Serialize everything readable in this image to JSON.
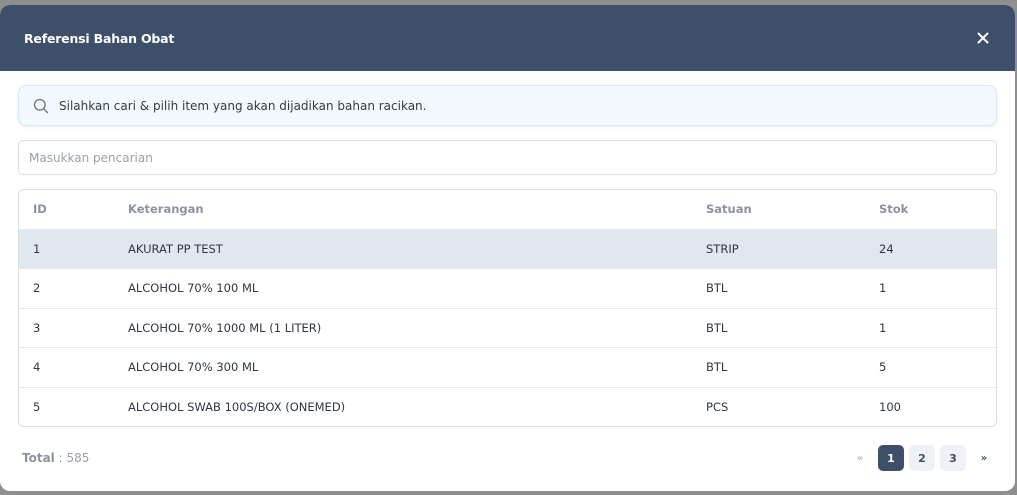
{
  "modal": {
    "title": "Referensi Bahan Obat"
  },
  "info": {
    "text": "Silahkan cari & pilih item yang akan dijadikan bahan racikan."
  },
  "search": {
    "placeholder": "Masukkan pencarian",
    "value": ""
  },
  "table": {
    "headers": [
      "ID",
      "Keterangan",
      "Satuan",
      "Stok"
    ],
    "rows": [
      {
        "id": "1",
        "keterangan": "AKURAT PP TEST",
        "satuan": "STRIP",
        "stok": "24",
        "selected": true
      },
      {
        "id": "2",
        "keterangan": "ALCOHOL 70% 100 ML",
        "satuan": "BTL",
        "stok": "1",
        "selected": false
      },
      {
        "id": "3",
        "keterangan": "ALCOHOL 70% 1000 ML (1 LITER)",
        "satuan": "BTL",
        "stok": "1",
        "selected": false
      },
      {
        "id": "4",
        "keterangan": "ALCOHOL 70% 300 ML",
        "satuan": "BTL",
        "stok": "5",
        "selected": false
      },
      {
        "id": "5",
        "keterangan": "ALCOHOL SWAB 100S/BOX (ONEMED)",
        "satuan": "PCS",
        "stok": "100",
        "selected": false
      }
    ]
  },
  "footer": {
    "total_label": "Total",
    "total_value": ": 585"
  },
  "pagination": {
    "prev": "«",
    "pages": [
      "1",
      "2",
      "3"
    ],
    "active_page": "1",
    "next": "»"
  },
  "colors": {
    "header_bg": "#3d4f69",
    "selected_row": "#e1e7ef",
    "info_bg": "#f2f9fc"
  },
  "icons": {
    "close": "close-icon",
    "search": "search-icon"
  }
}
